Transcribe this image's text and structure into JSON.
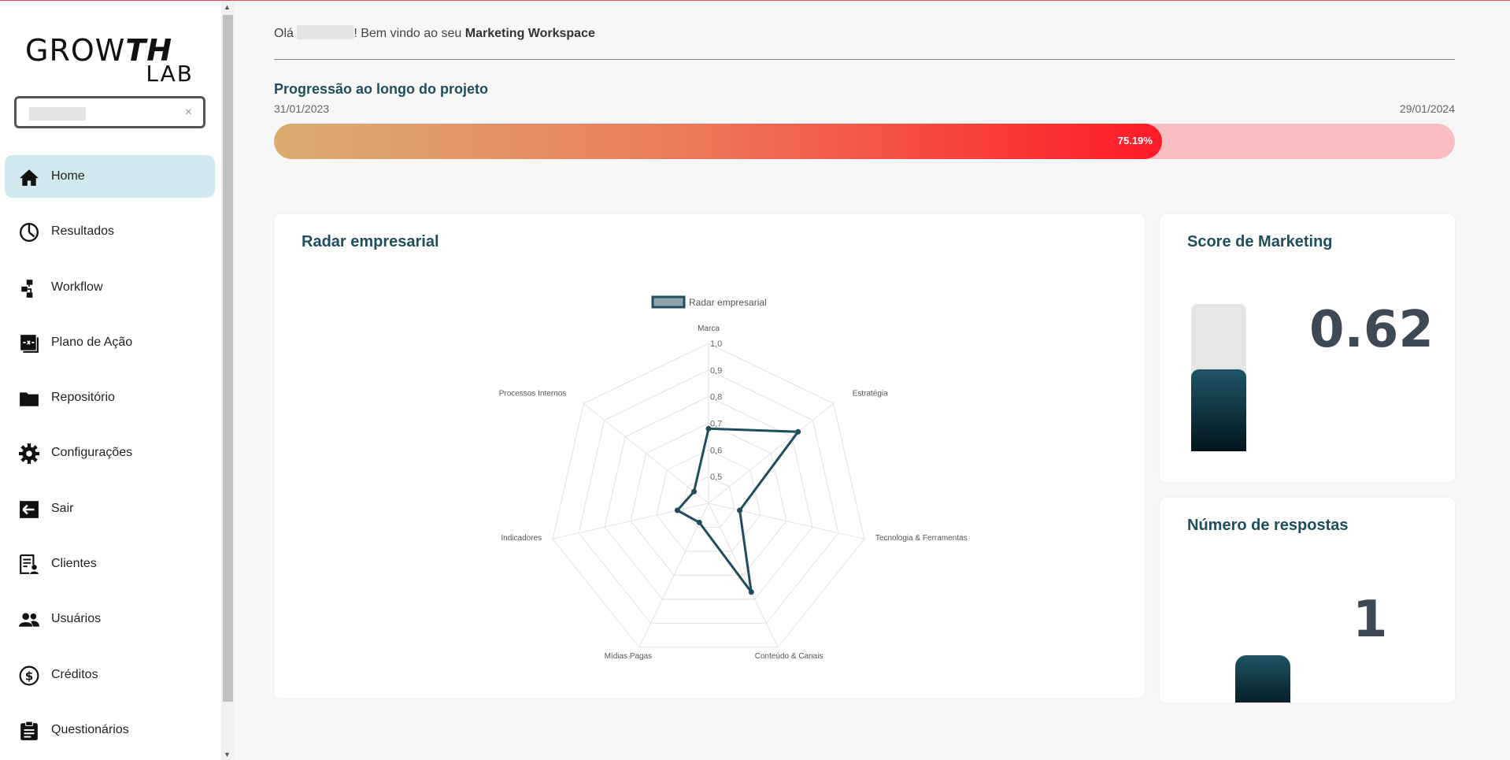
{
  "app": {
    "logo_line1_a": "GROW",
    "logo_line1_b": "TH",
    "logo_line2": "LAB"
  },
  "client_select": {
    "value": "",
    "clear_label": "×"
  },
  "sidebar": {
    "items": [
      {
        "label": "Home",
        "icon": "home-icon",
        "active": true
      },
      {
        "label": "Resultados",
        "icon": "pie-chart-icon"
      },
      {
        "label": "Workflow",
        "icon": "workflow-icon"
      },
      {
        "label": "Plano de Ação",
        "icon": "action-plan-icon"
      },
      {
        "label": "Repositório",
        "icon": "folder-icon"
      },
      {
        "label": "Configurações",
        "icon": "gear-icon"
      },
      {
        "label": "Sair",
        "icon": "logout-icon"
      },
      {
        "label": "Clientes",
        "icon": "clients-icon"
      },
      {
        "label": "Usuários",
        "icon": "users-icon"
      },
      {
        "label": "Créditos",
        "icon": "dollar-icon"
      },
      {
        "label": "Questionários",
        "icon": "clipboard-icon"
      }
    ]
  },
  "greeting": {
    "prefix": "Olá ",
    "suffix": "! Bem vindo ao seu ",
    "workspace": "Marketing Workspace"
  },
  "progress": {
    "title": "Progressão ao longo do projeto",
    "start_date": "31/01/2023",
    "end_date": "29/01/2024",
    "value": 75.19,
    "label": "75.19%"
  },
  "radar_card": {
    "title": "Radar empresarial"
  },
  "score_card": {
    "title": "Score de Marketing",
    "value_label": "0.62",
    "value": 0.62
  },
  "responses_card": {
    "title": "Número de respostas",
    "value_label": "1"
  },
  "colors": {
    "accent": "#1f4e5f",
    "active_nav": "#d2e8ef",
    "progress_end": "#ff1a28"
  },
  "chart_data": {
    "type": "radar",
    "legend": [
      "Radar empresarial"
    ],
    "categories": [
      "Marca",
      "Estratégia",
      "Tecnologia & Ferramentas",
      "Conteúdo & Canais",
      "Mídias Pagas",
      "Indicadores",
      "Processos Internos"
    ],
    "tick_labels": [
      "0,5",
      "0,6",
      "0,7",
      "0,8",
      "0,9",
      "1,0"
    ],
    "rmin": 0.4,
    "rmax": 1.0,
    "series": [
      {
        "name": "Radar empresarial",
        "values": [
          0.68,
          0.83,
          0.52,
          0.77,
          0.48,
          0.52,
          0.47
        ]
      }
    ]
  }
}
